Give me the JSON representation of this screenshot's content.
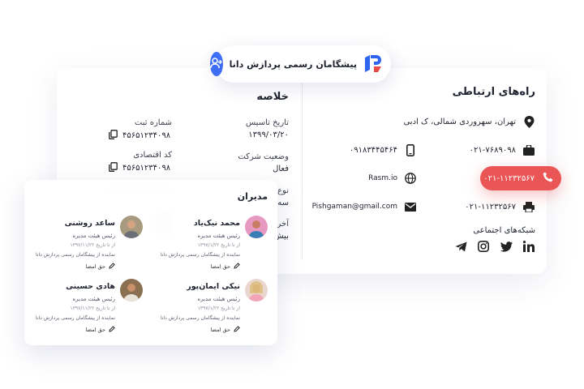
{
  "header": {
    "brand": "پیشگامان رسمی پردازش دانا",
    "logo_icon": "company-logo-icon",
    "add_icon": "add-user-icon",
    "accent": "#3d6ef5"
  },
  "contact": {
    "title": "راه‌های ارتباطی",
    "address": "تهران، سهروردی شمالی، ک ادبی",
    "rows": [
      {
        "icon": "briefcase-icon",
        "value": "۰۲۱-۷۶۸۹۰۹۸"
      },
      {
        "icon": "mobile-icon",
        "value": "۰۹۱۸۳۴۴۵۴۶۴"
      },
      {
        "icon": "globe-icon",
        "value": "Rasm.io"
      },
      {
        "icon": "fax-icon",
        "value": "۰۲۱-۱۱۲۳۲۵۶۷"
      },
      {
        "icon": "email-icon",
        "value": "Pishgaman@gmail.com"
      }
    ],
    "social_title": "شبکه‌های اجتماعی",
    "social": [
      "linkedin-icon",
      "twitter-icon",
      "instagram-icon",
      "telegram-icon"
    ],
    "call_number": "۰۲۱-۱۱۲۳۲۵۶۷",
    "call_color": "#ea5555"
  },
  "summary": {
    "title": "خلاصه",
    "founded_label": "تاریخ تاسیس",
    "founded_value": "۱۳۹۹/۰۳/۲۰",
    "reg_label": "شماره ثبت",
    "reg_value": "۴۵۶۵۱۲۳۴۰۹۸",
    "status_label": "وضعیت شرکت",
    "status_value": "فعال",
    "econ_label": "کد اقتصادی",
    "econ_value": "۴۵۶۵۱۲۳۴۰۹۸",
    "type_label": "نوع",
    "type_value": "سه",
    "last_label": "آخر",
    "last_value": "بیش"
  },
  "managers": {
    "title": "مدیران",
    "people": [
      {
        "name": "محمد نیک‌یاد",
        "role": "رئیس هیئت مدیره",
        "date": "از تا تاریخ ۱۳۹۷/۱/۲۲",
        "rep": "نماینده از پیشگامان رسمی پردازش دانا",
        "sign": "حق امضا"
      },
      {
        "name": "ساعد روشنی",
        "role": "رئیس هیئت مدیره",
        "date": "از تا تاریخ ۱۳۹۷/۱۱/۲۲",
        "rep": "نماینده از پیشگامان رسمی پردازش دانا",
        "sign": "حق امضا"
      },
      {
        "name": "نیکی ایمان‌پور",
        "role": "رئیس هیئت مدیره",
        "date": "از تا تاریخ ۱۳۹۷/۱/۲۲",
        "rep": "نماینده از پیشگامان رسمی پردازش دانا",
        "sign": "حق امضا"
      },
      {
        "name": "هادی حسینی",
        "role": "رئیس هیئت مدیره",
        "date": "از تا تاریخ ۱۳۹۷/۱۱/۲۲",
        "rep": "نماینده از پیشگامان رسمی پردازش دانا",
        "sign": "حق امضا"
      }
    ]
  }
}
